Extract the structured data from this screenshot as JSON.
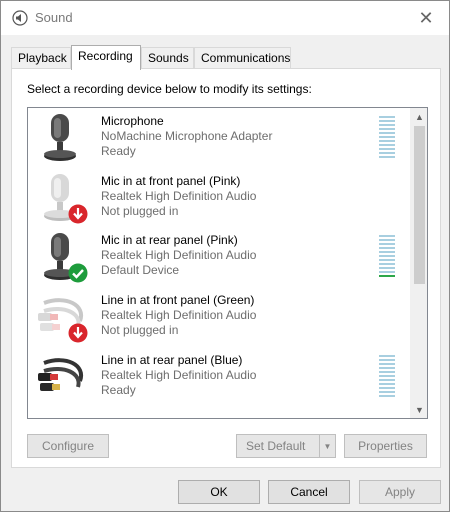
{
  "window": {
    "title": "Sound",
    "close_symbol": "✕"
  },
  "tabs": [
    {
      "label": "Playback",
      "active": false
    },
    {
      "label": "Recording",
      "active": true
    },
    {
      "label": "Sounds",
      "active": false
    },
    {
      "label": "Communications",
      "active": false
    }
  ],
  "recording": {
    "instruction": "Select a recording device below to modify its settings:",
    "devices": [
      {
        "name": "Microphone",
        "driver": "NoMachine Microphone Adapter",
        "status": "Ready",
        "icon": "microphone-icon",
        "badge": null,
        "level_bars_active": 0
      },
      {
        "name": "Mic in at front panel (Pink)",
        "driver": "Realtek High Definition Audio",
        "status": "Not plugged in",
        "icon": "microphone-icon",
        "badge": "unplugged-badge-icon",
        "level_bars_active": null
      },
      {
        "name": "Mic in at rear panel (Pink)",
        "driver": "Realtek High Definition Audio",
        "status": "Default Device",
        "icon": "microphone-icon",
        "badge": "default-device-check-icon",
        "level_bars_active": 1
      },
      {
        "name": "Line in at front panel (Green)",
        "driver": "Realtek High Definition Audio",
        "status": "Not plugged in",
        "icon": "line-in-cable-icon",
        "badge": "unplugged-badge-icon",
        "level_bars_active": null
      },
      {
        "name": "Line in at rear panel (Blue)",
        "driver": "Realtek High Definition Audio",
        "status": "Ready",
        "icon": "line-in-cable-icon",
        "badge": null,
        "level_bars_active": 0
      }
    ]
  },
  "buttons": {
    "configure": "Configure",
    "set_default": "Set Default",
    "properties": "Properties",
    "ok": "OK",
    "cancel": "Cancel",
    "apply": "Apply"
  },
  "colors": {
    "level_meter_idle": "#a8cfe0",
    "level_meter_active": "#2da74a",
    "unplugged_badge": "#d9262c",
    "default_badge": "#1e9c3c"
  }
}
